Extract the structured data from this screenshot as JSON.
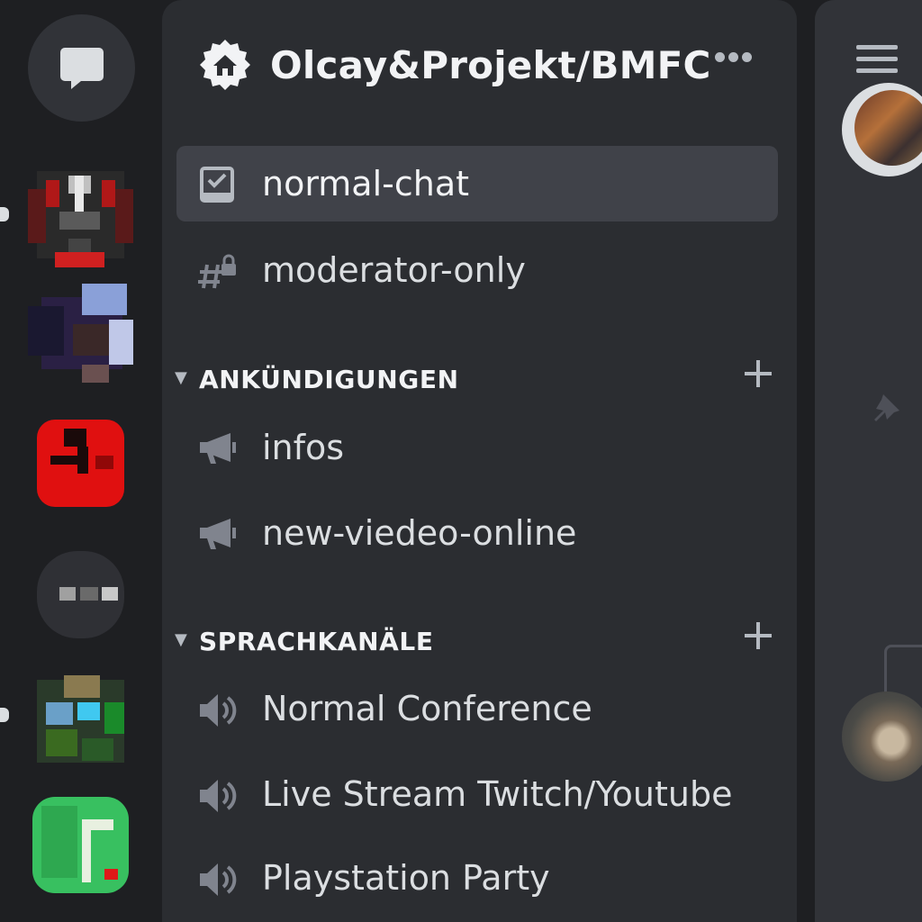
{
  "server": {
    "name": "Olcay&Projekt/BMFC"
  },
  "channels": [
    {
      "label": "normal-chat",
      "icon": "rules-channel-icon",
      "selected": true
    },
    {
      "label": "moderator-only",
      "icon": "locked-hash-icon",
      "selected": false
    }
  ],
  "categories": [
    {
      "label": "ANKÜNDIGUNGEN",
      "channels": [
        {
          "label": "infos",
          "icon": "announcement-icon"
        },
        {
          "label": "new-viedeo-online",
          "icon": "announcement-icon"
        }
      ]
    },
    {
      "label": "SPRACHKANÄLE",
      "channels": [
        {
          "label": "Normal Conference",
          "icon": "speaker-icon"
        },
        {
          "label": "Live Stream Twitch/Youtube",
          "icon": "speaker-icon"
        },
        {
          "label": "Playstation Party",
          "icon": "speaker-icon"
        }
      ]
    }
  ],
  "colors": {
    "rail_bg": "#1e1f22",
    "sidebar_bg": "#2b2d31",
    "selected_bg": "#404249",
    "text_primary": "#f2f3f5",
    "text_muted": "#b5bac1",
    "icon_muted": "#80848e"
  }
}
